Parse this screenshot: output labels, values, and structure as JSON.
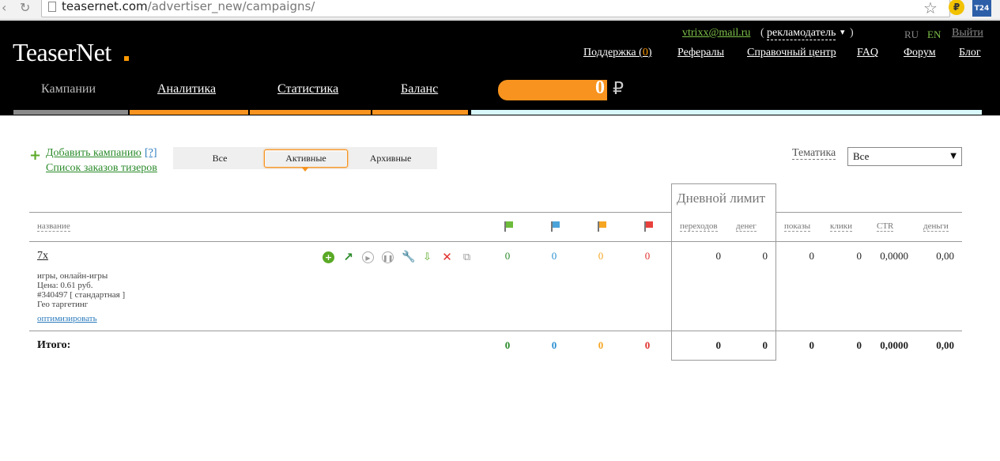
{
  "browser": {
    "url_host": "teasernet.com",
    "url_path": "/advertiser_new/campaigns/"
  },
  "header": {
    "logo": "TeaserNet",
    "user_email": "vtrixx@mail.ru",
    "role": "рекламодатель",
    "lang_ru": "RU",
    "lang_en": "EN",
    "logout": "Выйти",
    "links": {
      "support": "Поддержка (",
      "support_count": "0",
      "support_close": ")",
      "referrals": "Рефералы",
      "help_center": "Справочный центр",
      "faq": "FAQ",
      "forum": "Форум",
      "blog": "Блог"
    },
    "tabs": {
      "campaigns": "Кампании",
      "analytics": "Аналитика",
      "statistics": "Статистика",
      "balance": "Баланс"
    },
    "balance_value": "0",
    "balance_currency": "₽"
  },
  "controls": {
    "add_campaign": "Добавить кампанию",
    "help": "[?]",
    "orders_list": "Список заказов тизеров",
    "filters": [
      "Все",
      "Активные",
      "Архивные"
    ],
    "theme_label": "Тематика",
    "theme_value": "Все"
  },
  "table": {
    "daily_limit": "Дневной лимит",
    "headers": {
      "name": "название",
      "clicks_limit": "переходов",
      "money_limit": "денег",
      "impressions": "показы",
      "clicks": "клики",
      "ctr": "CTR",
      "money": "деньги"
    },
    "flag_colors": [
      "#6dbb3a",
      "#4ba3d9",
      "#f5a623",
      "#e8413c"
    ],
    "row": {
      "name": "7x",
      "category": "игры, онлайн-игры",
      "price": "Цена: 0.61 руб.",
      "id_line": "#340497 [ стандартная ]",
      "geo": "Гео таргетинг",
      "optimize": "оптимизировать",
      "flags": [
        "0",
        "0",
        "0",
        "0"
      ],
      "limit_clicks": "0",
      "limit_money": "0",
      "impressions": "0",
      "clicks": "0",
      "ctr": "0,0000",
      "money": "0,00"
    },
    "total": {
      "label": "Итого:",
      "flags": [
        "0",
        "0",
        "0",
        "0"
      ],
      "limit_clicks": "0",
      "limit_money": "0",
      "impressions": "0",
      "clicks": "0",
      "ctr": "0,0000",
      "money": "0,00"
    }
  }
}
